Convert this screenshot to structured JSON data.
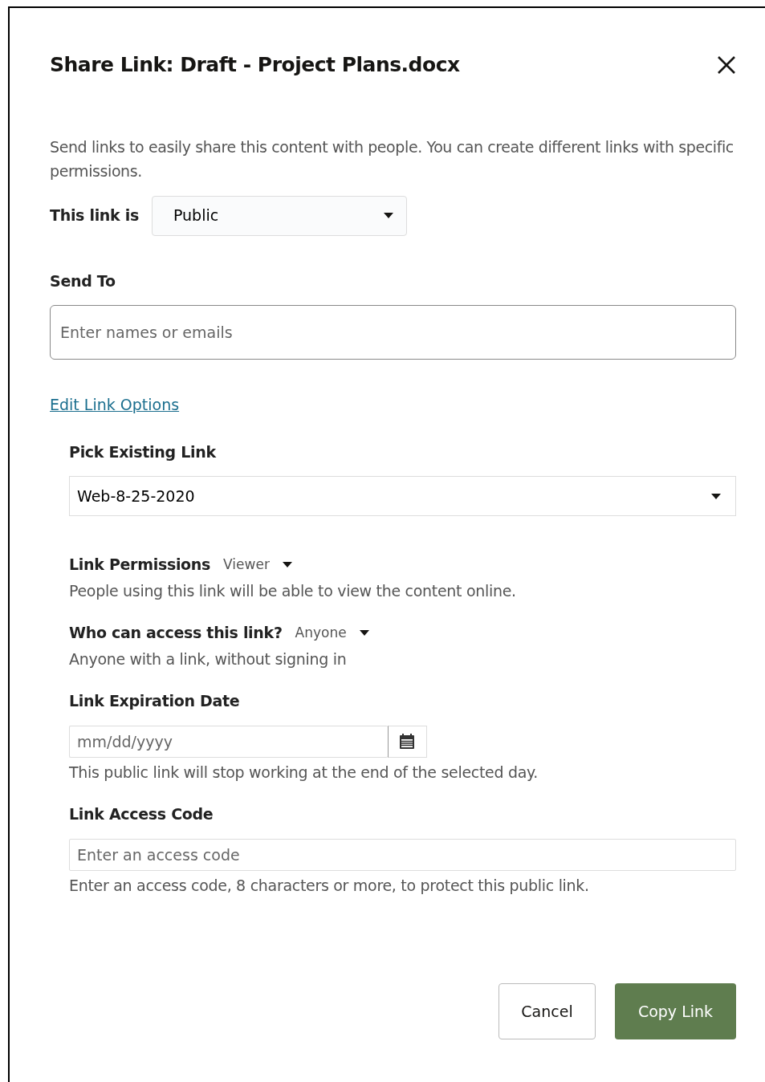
{
  "dialog": {
    "title": "Share Link: Draft - Project Plans.docx",
    "description": "Send links to easily share this content with people. You can create different links with specific permissions.",
    "link_type": {
      "label": "This link is",
      "value": "Public"
    },
    "send_to": {
      "label": "Send To",
      "placeholder": "Enter names or emails"
    },
    "edit_link_options": "Edit Link Options",
    "options": [
      {
        "kind": "select",
        "label": "Pick Existing Link",
        "value": "Web-8-25-2020"
      },
      {
        "kind": "inline-select",
        "label": "Link Permissions",
        "value": "Viewer",
        "help": "People using this link will be able to view the content online."
      },
      {
        "kind": "inline-select",
        "label": "Who can access this link?",
        "value": "Anyone",
        "help": "Anyone with a link, without signing in"
      },
      {
        "kind": "date",
        "label": "Link Expiration Date",
        "placeholder": "mm/dd/yyyy",
        "help": "This public link will stop working at the end of the selected day."
      },
      {
        "kind": "text",
        "label": "Link Access Code",
        "placeholder": "Enter an access code",
        "help": "Enter an access code, 8 characters or more, to protect this public link."
      }
    ],
    "buttons": [
      {
        "kind": "secondary",
        "label": "Cancel"
      },
      {
        "kind": "primary",
        "label": "Copy Link"
      }
    ]
  }
}
